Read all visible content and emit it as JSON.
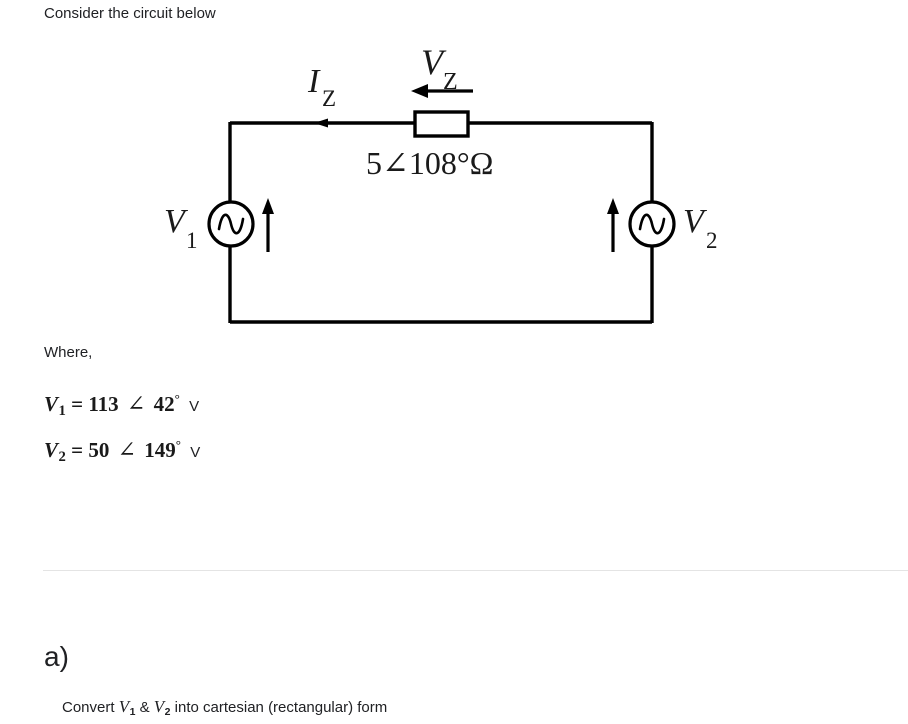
{
  "prompt": {
    "text": "Consider the circuit below"
  },
  "circuit": {
    "current_label": {
      "symbol": "I",
      "subscript": "Z"
    },
    "element_voltage_label": {
      "symbol": "V",
      "subscript": "Z"
    },
    "impedance_label": "5∠108°Ω",
    "source_left": {
      "symbol": "V",
      "subscript": "1"
    },
    "source_right": {
      "symbol": "V",
      "subscript": "2"
    },
    "icons": {
      "ac_source": "ac-source-sine-icon",
      "current_arrow": "current-arrow-right-icon",
      "voltage_arrow": "voltage-arrow-left-icon",
      "polarity_arrow_left": "polarity-arrow-up-icon",
      "polarity_arrow_right": "polarity-arrow-up-icon",
      "impedance_box": "impedance-element-icon"
    },
    "wire_color": "#000000"
  },
  "where": {
    "label": "Where,"
  },
  "equations": [
    {
      "symbol": "V",
      "subscript": "1",
      "equals": "=",
      "magnitude": "113",
      "angle_sign": "∠",
      "phase": "42",
      "degree": "°",
      "unit": "V"
    },
    {
      "symbol": "V",
      "subscript": "2",
      "equals": "=",
      "magnitude": "50",
      "angle_sign": "∠",
      "phase": "149",
      "degree": "°",
      "unit": "V"
    }
  ],
  "part_a": {
    "heading": "a)",
    "text_before": "Convert ",
    "var1": {
      "symbol": "V",
      "subscript": "1"
    },
    "text_middle": " & ",
    "var2": {
      "symbol": "V",
      "subscript": "2"
    },
    "text_after": " into cartesian (rectangular) form"
  }
}
